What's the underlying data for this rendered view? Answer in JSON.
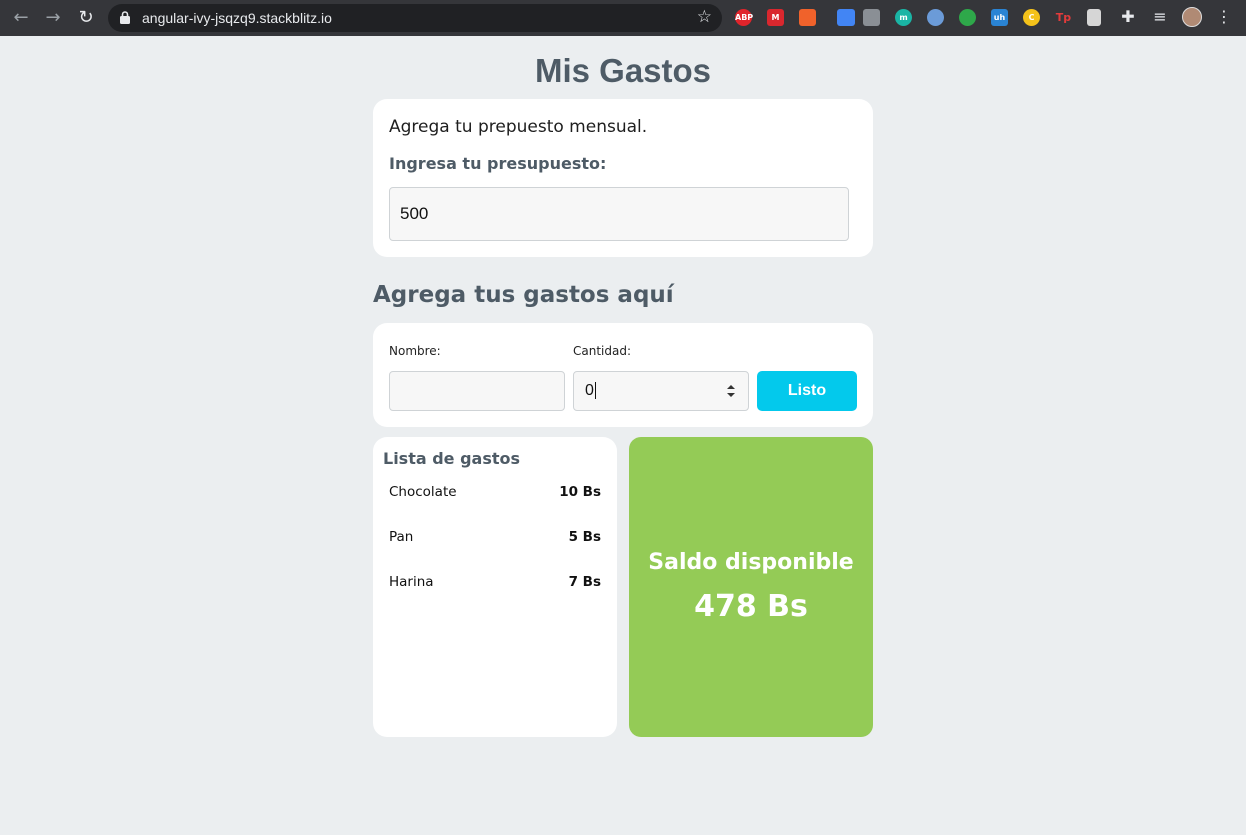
{
  "browser": {
    "url": "angular-ivy-jsqzq9.stackblitz.io",
    "extensions": [
      {
        "name": "adblock",
        "label": "ABP",
        "color": "#e0242b"
      },
      {
        "name": "mega",
        "label": "M",
        "color": "#d9272e"
      },
      {
        "name": "ext-orange",
        "label": "",
        "color": "#f0622b"
      },
      {
        "name": "ext-pen",
        "label": "",
        "color": "#4285f4"
      },
      {
        "name": "ext-gray",
        "label": "",
        "color": "#8a8f95"
      },
      {
        "name": "ext-teal",
        "label": "m",
        "color": "#1ab5a5"
      },
      {
        "name": "ext-blue-ring",
        "label": "",
        "color": "#6b9bd8"
      },
      {
        "name": "ext-colorful",
        "label": "",
        "color": "#2ea84a"
      },
      {
        "name": "ext-uh",
        "label": "uh",
        "color": "#2a84d4"
      },
      {
        "name": "ext-yellow",
        "label": "C",
        "color": "#f4c21a"
      },
      {
        "name": "ext-tp",
        "label": "Tp",
        "color": "#e23b3b"
      },
      {
        "name": "ext-doc",
        "label": "",
        "color": "#d6d6d6"
      }
    ]
  },
  "page": {
    "title": "Mis Gastos"
  },
  "budget": {
    "intro": "Agrega tu prepuesto mensual.",
    "label": "Ingresa tu presupuesto:",
    "value": "500"
  },
  "expense_form": {
    "section_title": "Agrega tus gastos aquí",
    "name_label": "Nombre:",
    "name_value": "",
    "quantity_label": "Cantidad:",
    "quantity_value": "0",
    "submit_label": "Listo"
  },
  "expense_list": {
    "title": "Lista de gastos",
    "items": [
      {
        "name": "Chocolate",
        "amount": "10 Bs"
      },
      {
        "name": "Pan",
        "amount": "5 Bs"
      },
      {
        "name": "Harina",
        "amount": "7 Bs"
      }
    ]
  },
  "balance": {
    "label": "Saldo disponible",
    "amount": "478 Bs",
    "color": "#94cb56"
  },
  "colors": {
    "accent": "#03c9ec",
    "heading": "#4e5b66",
    "background": "#ebeef0"
  }
}
